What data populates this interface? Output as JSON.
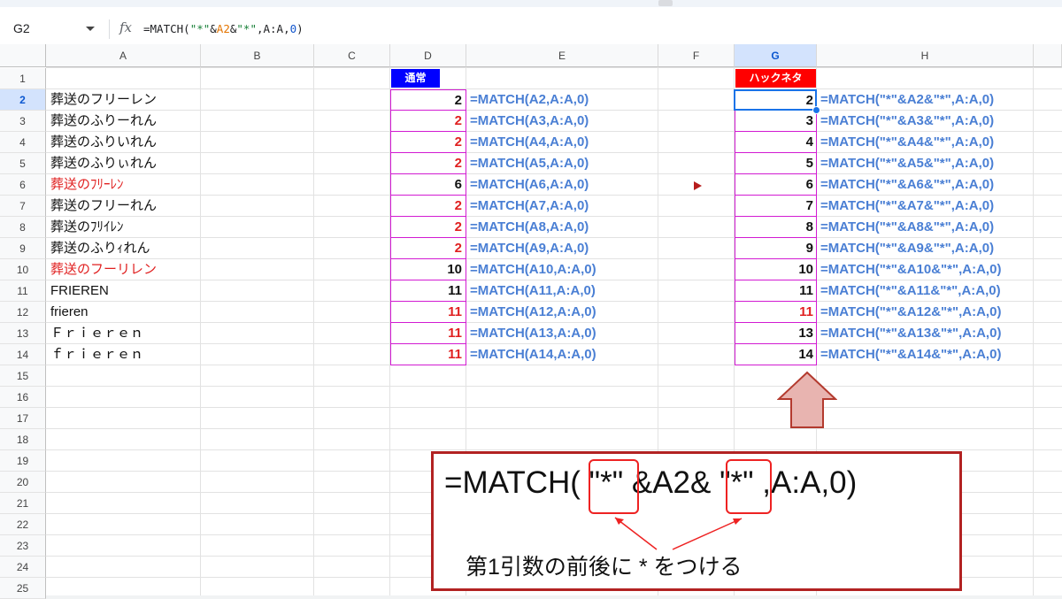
{
  "formula_bar": {
    "name_box": "G2",
    "fx": "fx",
    "formula_parts": [
      "=MATCH(",
      "\"*\"",
      "&",
      "A2",
      "&",
      "\"*\"",
      ",A:A,",
      "0",
      ")"
    ]
  },
  "columns": [
    "A",
    "B",
    "C",
    "D",
    "E",
    "F",
    "G",
    "H"
  ],
  "rows": [
    "1",
    "2",
    "3",
    "4",
    "5",
    "6",
    "7",
    "8",
    "9",
    "10",
    "11",
    "12",
    "13",
    "14",
    "15",
    "16",
    "17",
    "18",
    "19",
    "20",
    "21",
    "22",
    "23",
    "24",
    "25"
  ],
  "headers": {
    "normal": "通常",
    "hack": "ハックネタ"
  },
  "colors": {
    "normal_badge": "#0000ff",
    "hack_badge": "#ff0000",
    "match_ok": "#111111",
    "match_wrong": "#e02020",
    "formula_text": "#4a7fd4",
    "range_border": "#d21bd2",
    "selection": "#1a73e8"
  },
  "col_a": [
    {
      "text": "葬送のフリーレン",
      "red": false
    },
    {
      "text": "葬送のふりーれん",
      "red": false
    },
    {
      "text": "葬送のふりいれん",
      "red": false
    },
    {
      "text": "葬送のふりぃれん",
      "red": false
    },
    {
      "text": "葬送のﾌﾘｰﾚﾝ",
      "red": true
    },
    {
      "text": "葬送のフリーれん",
      "red": false
    },
    {
      "text": "葬送のﾌﾘｲﾚﾝ",
      "red": false
    },
    {
      "text": "葬送のふりｨれん",
      "red": false
    },
    {
      "text": "葬送のフーリレン",
      "red": true
    },
    {
      "text": "FRIEREN",
      "red": false
    },
    {
      "text": "frieren",
      "red": false
    },
    {
      "text": "Ｆｒｉｅｒｅｎ",
      "red": false
    },
    {
      "text": "ｆｒｉｅｒｅｎ",
      "red": false
    }
  ],
  "col_d": [
    {
      "value": "2",
      "wrong": false
    },
    {
      "value": "2",
      "wrong": true
    },
    {
      "value": "2",
      "wrong": true
    },
    {
      "value": "2",
      "wrong": true
    },
    {
      "value": "6",
      "wrong": false
    },
    {
      "value": "2",
      "wrong": true
    },
    {
      "value": "2",
      "wrong": true
    },
    {
      "value": "2",
      "wrong": true
    },
    {
      "value": "10",
      "wrong": false
    },
    {
      "value": "11",
      "wrong": false
    },
    {
      "value": "11",
      "wrong": true
    },
    {
      "value": "11",
      "wrong": true
    },
    {
      "value": "11",
      "wrong": true
    }
  ],
  "col_e": [
    "=MATCH(A2,A:A,0)",
    "=MATCH(A3,A:A,0)",
    "=MATCH(A4,A:A,0)",
    "=MATCH(A5,A:A,0)",
    "=MATCH(A6,A:A,0)",
    "=MATCH(A7,A:A,0)",
    "=MATCH(A8,A:A,0)",
    "=MATCH(A9,A:A,0)",
    "=MATCH(A10,A:A,0)",
    "=MATCH(A11,A:A,0)",
    "=MATCH(A12,A:A,0)",
    "=MATCH(A13,A:A,0)",
    "=MATCH(A14,A:A,0)"
  ],
  "col_g": [
    {
      "value": "2",
      "wrong": false
    },
    {
      "value": "3",
      "wrong": false
    },
    {
      "value": "4",
      "wrong": false
    },
    {
      "value": "5",
      "wrong": false
    },
    {
      "value": "6",
      "wrong": false
    },
    {
      "value": "7",
      "wrong": false
    },
    {
      "value": "8",
      "wrong": false
    },
    {
      "value": "9",
      "wrong": false
    },
    {
      "value": "10",
      "wrong": false
    },
    {
      "value": "11",
      "wrong": false
    },
    {
      "value": "11",
      "wrong": true
    },
    {
      "value": "13",
      "wrong": false
    },
    {
      "value": "14",
      "wrong": false
    }
  ],
  "col_h": [
    "=MATCH(\"*\"&A2&\"*\",A:A,0)",
    "=MATCH(\"*\"&A3&\"*\",A:A,0)",
    "=MATCH(\"*\"&A4&\"*\",A:A,0)",
    "=MATCH(\"*\"&A5&\"*\",A:A,0)",
    "=MATCH(\"*\"&A6&\"*\",A:A,0)",
    "=MATCH(\"*\"&A7&\"*\",A:A,0)",
    "=MATCH(\"*\"&A8&\"*\",A:A,0)",
    "=MATCH(\"*\"&A9&\"*\",A:A,0)",
    "=MATCH(\"*\"&A10&\"*\",A:A,0)",
    "=MATCH(\"*\"&A11&\"*\",A:A,0)",
    "=MATCH(\"*\"&A12&\"*\",A:A,0)",
    "=MATCH(\"*\"&A13&\"*\",A:A,0)",
    "=MATCH(\"*\"&A14&\"*\",A:A,0)"
  ],
  "callout": {
    "parts": [
      "=MATCH( ",
      "\"*\"",
      " &A2& ",
      "\"*\"",
      " ,A:A,0)"
    ],
    "note": "第1引数の前後に * をつける"
  },
  "icons": {
    "name_box_dropdown": "chevron-down-icon",
    "function": "fx-icon",
    "up_arrow": "up-arrow-icon",
    "play": "triangle-right-icon"
  }
}
